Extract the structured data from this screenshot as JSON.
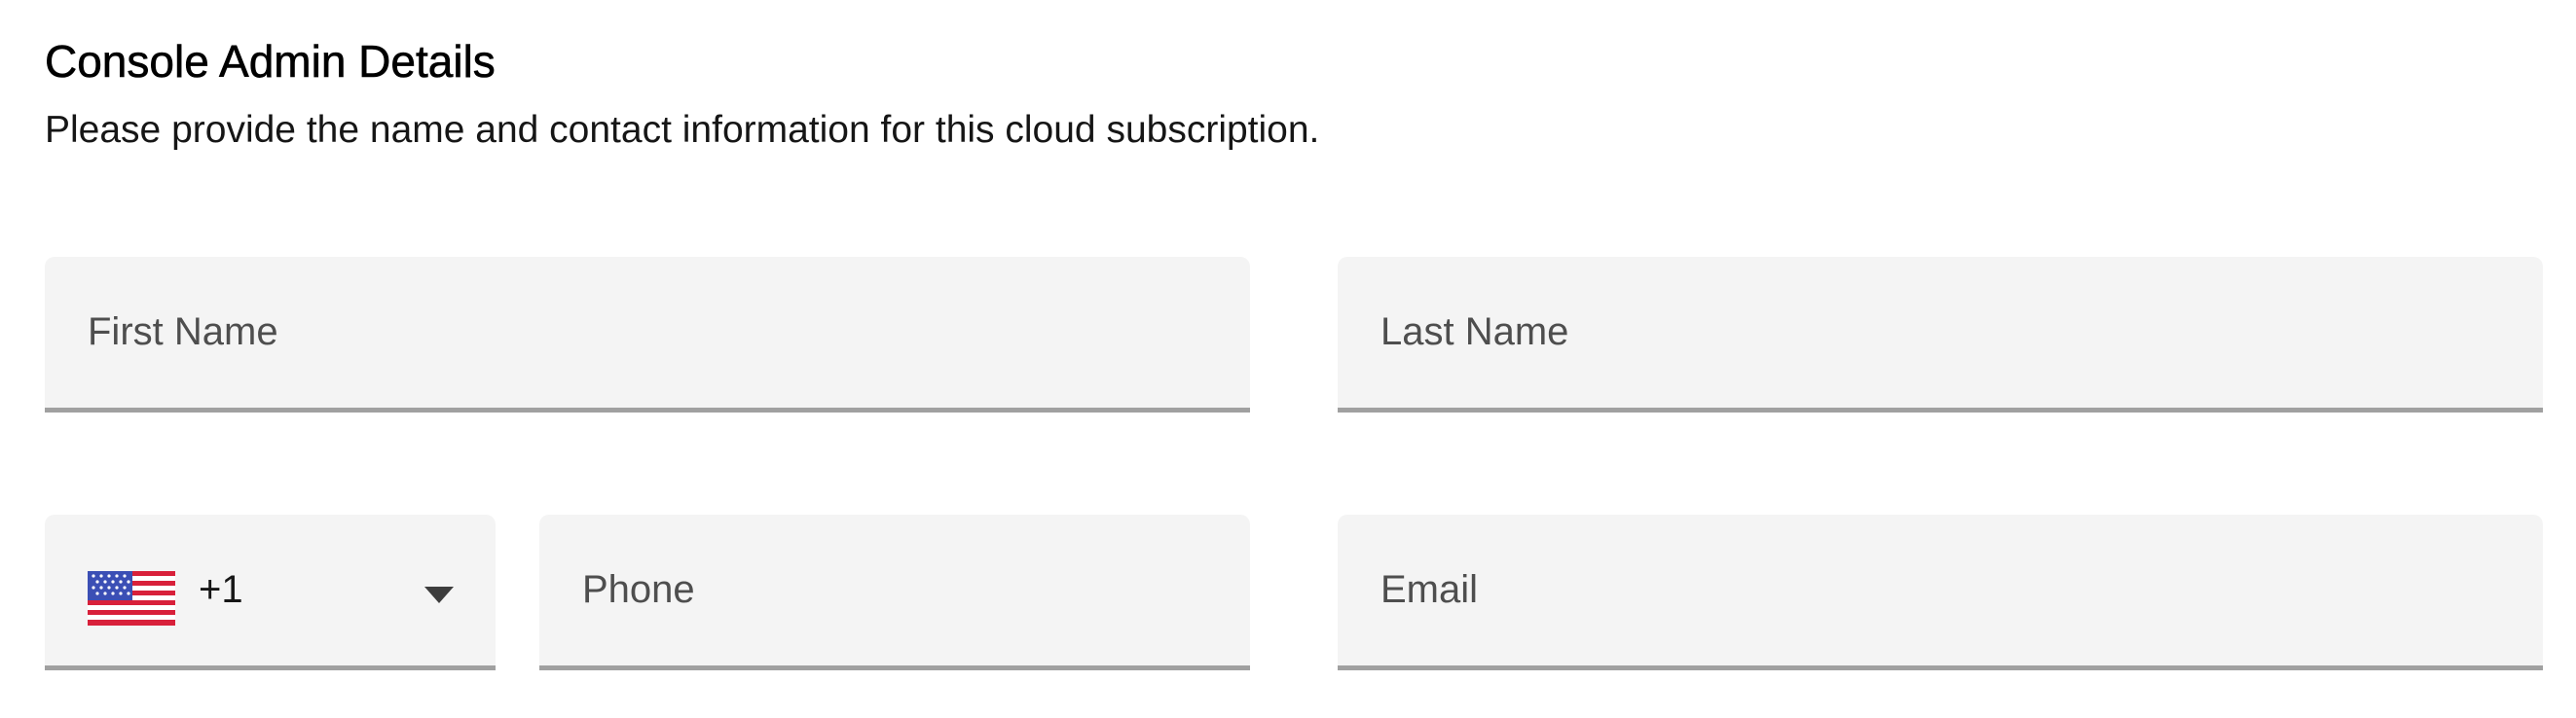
{
  "section": {
    "title": "Console Admin Details",
    "description": "Please provide the name and contact information for this cloud subscription."
  },
  "form": {
    "first_name": {
      "placeholder": "First Name",
      "value": ""
    },
    "last_name": {
      "placeholder": "Last Name",
      "value": ""
    },
    "country_code": {
      "flag_icon": "us-flag-icon",
      "value": "+1",
      "dropdown_icon": "caret-down-icon"
    },
    "phone": {
      "placeholder": "Phone",
      "value": ""
    },
    "email": {
      "placeholder": "Email",
      "value": ""
    }
  },
  "colors": {
    "field_background": "#f4f4f4",
    "field_underline": "#a0a0a0",
    "placeholder_text": "#4e4e4e",
    "flag_red": "#d8203a",
    "flag_blue": "#3b4fb5"
  }
}
